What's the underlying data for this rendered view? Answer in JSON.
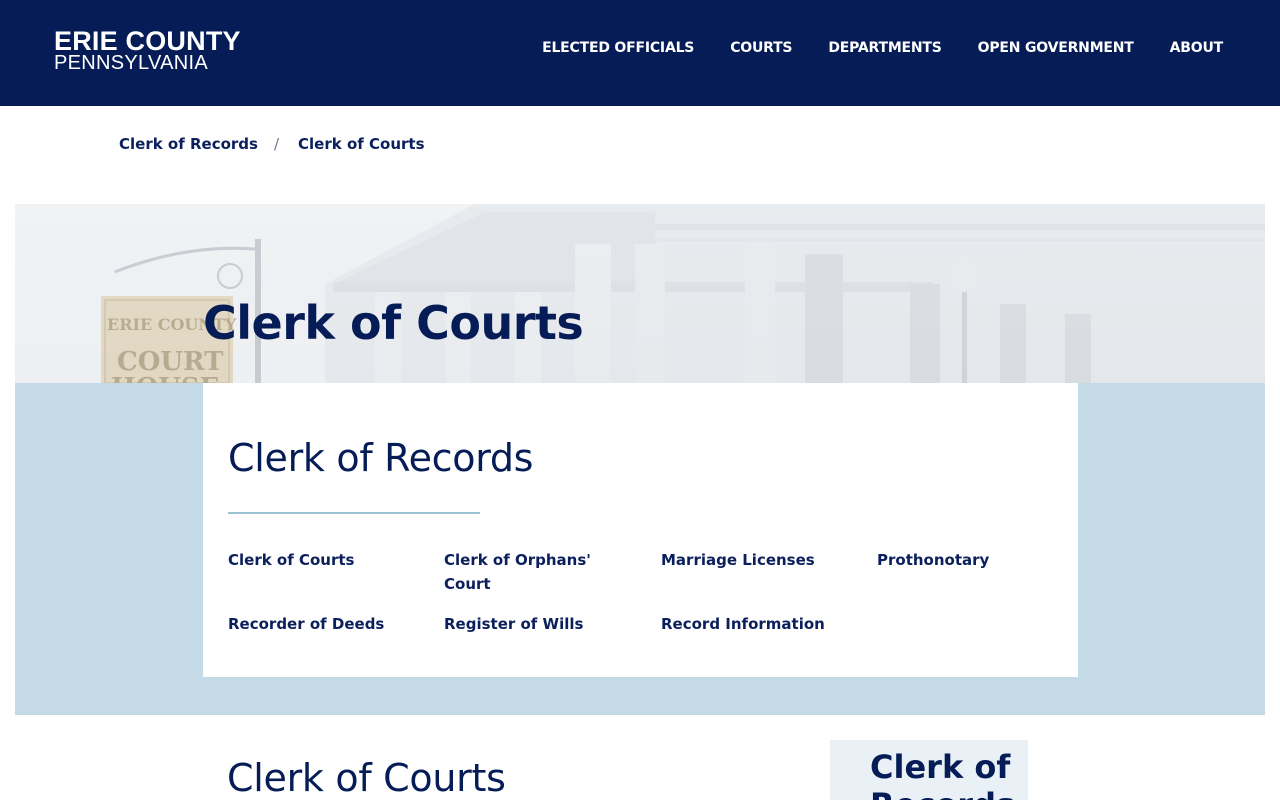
{
  "header": {
    "logo_line1": "ERIE COUNTY",
    "logo_line2": "PENNSYLVANIA",
    "nav": [
      {
        "label": "ELECTED OFFICIALS"
      },
      {
        "label": "COURTS"
      },
      {
        "label": "DEPARTMENTS"
      },
      {
        "label": "OPEN GOVERNMENT"
      },
      {
        "label": "ABOUT"
      }
    ]
  },
  "breadcrumb": {
    "items": [
      {
        "label": "Clerk of Records"
      },
      {
        "label": "Clerk of Courts"
      }
    ],
    "separator": "/"
  },
  "hero": {
    "title": "Clerk of Courts",
    "sign_line1": "ERIE COUNTY",
    "sign_line2": "COURT",
    "sign_line3": "HOUSE"
  },
  "records_card": {
    "title": "Clerk of Records",
    "links": [
      {
        "label": "Clerk of Courts"
      },
      {
        "label": "Clerk of Orphans' Court"
      },
      {
        "label": "Marriage Licenses"
      },
      {
        "label": "Prothonotary"
      },
      {
        "label": "Recorder of Deeds"
      },
      {
        "label": "Register of Wills"
      },
      {
        "label": "Record Information"
      }
    ]
  },
  "main": {
    "title": "Clerk of Courts"
  },
  "sidebar": {
    "title": "Clerk of Records"
  },
  "colors": {
    "header_bg": "#061c57",
    "band_bg": "#c4dbe7",
    "text_navy": "#0a1f5c"
  }
}
